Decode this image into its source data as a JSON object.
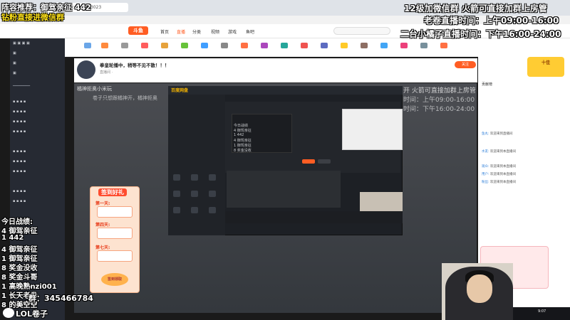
{
  "browser": {
    "url": "www.douyu.com/1303023"
  },
  "site": {
    "logo": "斗鱼",
    "nav": [
      "首页",
      "直播",
      "分类",
      "视频",
      "游戏",
      "鱼吧"
    ],
    "search_placeholder": ""
  },
  "stream": {
    "title": "拳皇轮播中，稍等不见不散！！！",
    "follow_label": "关注",
    "meta": "直播间 ·"
  },
  "overlays": {
    "left_top_1": "阵容推荐：御驾亲征  442",
    "left_top_2": "钻粉直接进微信群",
    "right_1": "12级加微信群 火箭可直接加群上房管",
    "right_2": "老卷直播时间：上午09:00-16:00",
    "right_3": "二台小橘子直播时间：下午16:00-24:00",
    "faint_1": "开 火箭可直接加群上房管",
    "faint_2": "时间：上午09:00-16:00",
    "faint_3": "时间：下午16:00-24:00",
    "qq": "群：345466784",
    "lol": "LOL卷子",
    "video_tl_1": "橘神拒奥小米玩",
    "video_tl_2": "卷子只想跟橘神开，橘神拒奥",
    "video_tl_3": ""
  },
  "score_lines": [
    "今日战绩:",
    "4 御驾亲征",
    "1 442",
    "4 御驾亲征",
    "1 御驾亲征",
    "8 奖金没收",
    "8 奖金斗哥",
    "1 高晚熟nzi001",
    "1 长天老卷",
    "8 的美空空"
  ],
  "app": {
    "title": "百度网盘",
    "list": [
      "今日战绩",
      "4 御驾亲征",
      "1 442",
      "4 御驾亲征",
      "1 御驾亲征",
      "8 奖金没收"
    ],
    "bottom": "查看更多"
  },
  "gift": {
    "title": "签到好礼",
    "days": [
      "第一天:",
      "第四天:",
      "第七天:"
    ],
    "sign_label": "签到领取"
  },
  "right": {
    "rank_label": "十佳",
    "contrib": "贡献榜",
    "chat": [
      {
        "name": "鱼丸:",
        "text": "欢迎来到直播间"
      },
      {
        "name": "水友:",
        "text": "欢迎来到本直播间"
      },
      {
        "name": "观众:",
        "text": "欢迎来到本直播间"
      },
      {
        "name": "用户:",
        "text": "欢迎来到本直播间"
      },
      {
        "name": "粉丝:",
        "text": "欢迎来到本直播间"
      }
    ],
    "popup_title": "",
    "popup_text": ""
  },
  "clock": "9:07",
  "colors": {
    "brand": "#ff5d23",
    "overlay_white": "#ffffff",
    "overlay_yellow": "#ffe21a"
  }
}
